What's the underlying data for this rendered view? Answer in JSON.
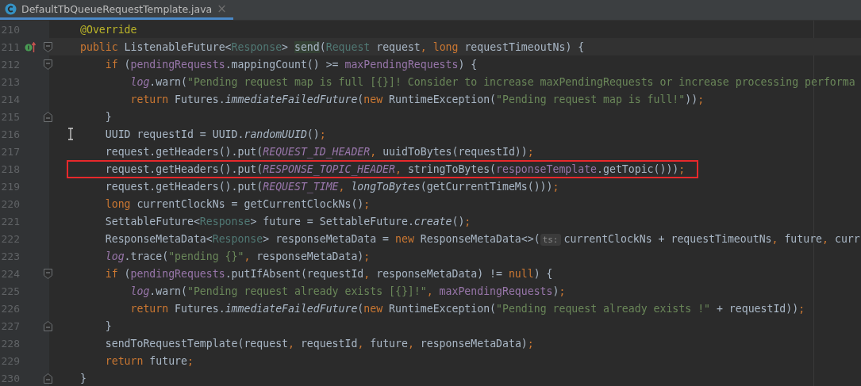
{
  "tab": {
    "label": "DefaultTbQueueRequestTemplate.java",
    "selected": true,
    "close": "×"
  },
  "lines": [
    {
      "number": "210",
      "tokens": [
        {
          "kind": "annotation",
          "text": "@Override"
        }
      ]
    },
    {
      "number": "211",
      "current": true,
      "overrides": true,
      "fold_start": true,
      "tokens": [
        {
          "kind": "keyword",
          "text": "public "
        },
        {
          "kind": "plain",
          "text": "ListenableFuture<"
        },
        {
          "kind": "type",
          "text": "Response"
        },
        {
          "kind": "plain",
          "text": "> "
        },
        {
          "kind": "match",
          "text": "send"
        },
        {
          "kind": "plain",
          "text": "("
        },
        {
          "kind": "type",
          "text": "Request"
        },
        {
          "kind": "plain",
          "text": " request"
        },
        {
          "kind": "punct",
          "text": ", "
        },
        {
          "kind": "keyword",
          "text": "long "
        },
        {
          "kind": "plain",
          "text": "requestTimeoutNs) {"
        }
      ]
    },
    {
      "number": "212",
      "fold_start": true,
      "tokens": [
        {
          "kind": "keyword",
          "text": "    if "
        },
        {
          "kind": "plain",
          "text": "("
        },
        {
          "kind": "field",
          "text": "pendingRequests"
        },
        {
          "kind": "plain",
          "text": ".mappingCount() >= "
        },
        {
          "kind": "field",
          "text": "maxPendingRequests"
        },
        {
          "kind": "plain",
          "text": ") {"
        }
      ]
    },
    {
      "number": "213",
      "tokens": [
        {
          "kind": "static_field",
          "text": "        log"
        },
        {
          "kind": "plain",
          "text": ".warn("
        },
        {
          "kind": "string",
          "text": "\"Pending request map is full [{}]! Consider to increase maxPendingRequests or increase processing performa"
        }
      ]
    },
    {
      "number": "214",
      "tokens": [
        {
          "kind": "keyword",
          "text": "        return "
        },
        {
          "kind": "plain",
          "text": "Futures."
        },
        {
          "kind": "static_call",
          "text": "immediateFailedFuture"
        },
        {
          "kind": "plain",
          "text": "("
        },
        {
          "kind": "keyword",
          "text": "new "
        },
        {
          "kind": "plain",
          "text": "RuntimeException("
        },
        {
          "kind": "string",
          "text": "\"Pending request map is full!\""
        },
        {
          "kind": "plain",
          "text": "))"
        },
        {
          "kind": "punct",
          "text": ";"
        }
      ]
    },
    {
      "number": "215",
      "fold_end": true,
      "tokens": [
        {
          "kind": "plain",
          "text": "    }"
        }
      ]
    },
    {
      "number": "216",
      "pointer": true,
      "tokens": [
        {
          "kind": "plain",
          "text": "    UUID requestId = UUID."
        },
        {
          "kind": "static_call",
          "text": "randomUUID"
        },
        {
          "kind": "plain",
          "text": "()"
        },
        {
          "kind": "punct",
          "text": ";"
        }
      ]
    },
    {
      "number": "217",
      "tokens": [
        {
          "kind": "plain",
          "text": "    request.getHeaders().put("
        },
        {
          "kind": "static_field",
          "text": "REQUEST_ID_HEADER"
        },
        {
          "kind": "punct",
          "text": ", "
        },
        {
          "kind": "plain",
          "text": "uuidToBytes(requestId))"
        },
        {
          "kind": "punct",
          "text": ";"
        }
      ]
    },
    {
      "number": "218",
      "boxed": true,
      "tokens": [
        {
          "kind": "plain",
          "text": "    request.getHeaders().put("
        },
        {
          "kind": "static_field",
          "text": "RESPONSE_TOPIC_HEADER"
        },
        {
          "kind": "punct",
          "text": ", "
        },
        {
          "kind": "plain",
          "text": "stringToBytes("
        },
        {
          "kind": "field",
          "text": "responseTemplate"
        },
        {
          "kind": "plain",
          "text": ".getTopic()))"
        },
        {
          "kind": "punct",
          "text": ";"
        }
      ]
    },
    {
      "number": "219",
      "tokens": [
        {
          "kind": "plain",
          "text": "    request.getHeaders().put("
        },
        {
          "kind": "static_field",
          "text": "REQUEST_TIME"
        },
        {
          "kind": "punct",
          "text": ", "
        },
        {
          "kind": "static_call",
          "text": "longToBytes"
        },
        {
          "kind": "plain",
          "text": "(getCurrentTimeMs()))"
        },
        {
          "kind": "punct",
          "text": ";"
        }
      ]
    },
    {
      "number": "220",
      "tokens": [
        {
          "kind": "keyword",
          "text": "    long "
        },
        {
          "kind": "plain",
          "text": "currentClockNs = getCurrentClockNs()"
        },
        {
          "kind": "punct",
          "text": ";"
        }
      ]
    },
    {
      "number": "221",
      "tokens": [
        {
          "kind": "plain",
          "text": "    SettableFuture<"
        },
        {
          "kind": "type",
          "text": "Response"
        },
        {
          "kind": "plain",
          "text": "> future = SettableFuture."
        },
        {
          "kind": "static_call",
          "text": "create"
        },
        {
          "kind": "plain",
          "text": "()"
        },
        {
          "kind": "punct",
          "text": ";"
        }
      ]
    },
    {
      "number": "222",
      "tokens": [
        {
          "kind": "plain",
          "text": "    ResponseMetaData<"
        },
        {
          "kind": "type",
          "text": "Response"
        },
        {
          "kind": "plain",
          "text": "> responseMetaData = "
        },
        {
          "kind": "keyword",
          "text": "new "
        },
        {
          "kind": "plain",
          "text": "ResponseMetaData<>("
        },
        {
          "kind": "hint",
          "text": "ts:"
        },
        {
          "kind": "plain",
          "text": "currentClockNs + requestTimeoutNs"
        },
        {
          "kind": "punct",
          "text": ", "
        },
        {
          "kind": "plain",
          "text": "future"
        },
        {
          "kind": "punct",
          "text": ", "
        },
        {
          "kind": "plain",
          "text": "curr"
        }
      ]
    },
    {
      "number": "223",
      "tokens": [
        {
          "kind": "static_field",
          "text": "    log"
        },
        {
          "kind": "plain",
          "text": ".trace("
        },
        {
          "kind": "string",
          "text": "\"pending {}\""
        },
        {
          "kind": "punct",
          "text": ", "
        },
        {
          "kind": "plain",
          "text": "responseMetaData)"
        },
        {
          "kind": "punct",
          "text": ";"
        }
      ]
    },
    {
      "number": "224",
      "fold_start": true,
      "tokens": [
        {
          "kind": "keyword",
          "text": "    if "
        },
        {
          "kind": "plain",
          "text": "("
        },
        {
          "kind": "field",
          "text": "pendingRequests"
        },
        {
          "kind": "plain",
          "text": ".putIfAbsent(requestId"
        },
        {
          "kind": "punct",
          "text": ", "
        },
        {
          "kind": "plain",
          "text": "responseMetaData) != "
        },
        {
          "kind": "keyword",
          "text": "null"
        },
        {
          "kind": "plain",
          "text": ") {"
        }
      ]
    },
    {
      "number": "225",
      "tokens": [
        {
          "kind": "static_field",
          "text": "        log"
        },
        {
          "kind": "plain",
          "text": ".warn("
        },
        {
          "kind": "string",
          "text": "\"Pending request already exists [{}]!\""
        },
        {
          "kind": "punct",
          "text": ", "
        },
        {
          "kind": "field",
          "text": "maxPendingRequests"
        },
        {
          "kind": "plain",
          "text": ")"
        },
        {
          "kind": "punct",
          "text": ";"
        }
      ]
    },
    {
      "number": "226",
      "tokens": [
        {
          "kind": "keyword",
          "text": "        return "
        },
        {
          "kind": "plain",
          "text": "Futures."
        },
        {
          "kind": "static_call",
          "text": "immediateFailedFuture"
        },
        {
          "kind": "plain",
          "text": "("
        },
        {
          "kind": "keyword",
          "text": "new "
        },
        {
          "kind": "plain",
          "text": "RuntimeException("
        },
        {
          "kind": "string",
          "text": "\"Pending request already exists !\""
        },
        {
          "kind": "plain",
          "text": " + requestId))"
        },
        {
          "kind": "punct",
          "text": ";"
        }
      ]
    },
    {
      "number": "227",
      "fold_end": true,
      "tokens": [
        {
          "kind": "plain",
          "text": "    }"
        }
      ]
    },
    {
      "number": "228",
      "tokens": [
        {
          "kind": "plain",
          "text": "    sendToRequestTemplate(request"
        },
        {
          "kind": "punct",
          "text": ", "
        },
        {
          "kind": "plain",
          "text": "requestId"
        },
        {
          "kind": "punct",
          "text": ", "
        },
        {
          "kind": "plain",
          "text": "future"
        },
        {
          "kind": "punct",
          "text": ", "
        },
        {
          "kind": "plain",
          "text": "responseMetaData)"
        },
        {
          "kind": "punct",
          "text": ";"
        }
      ]
    },
    {
      "number": "229",
      "tokens": [
        {
          "kind": "keyword",
          "text": "    return "
        },
        {
          "kind": "plain",
          "text": "future"
        },
        {
          "kind": "punct",
          "text": ";"
        }
      ]
    },
    {
      "number": "230",
      "fold_end": true,
      "tokens": [
        {
          "kind": "plain",
          "text": "}"
        }
      ]
    }
  ]
}
